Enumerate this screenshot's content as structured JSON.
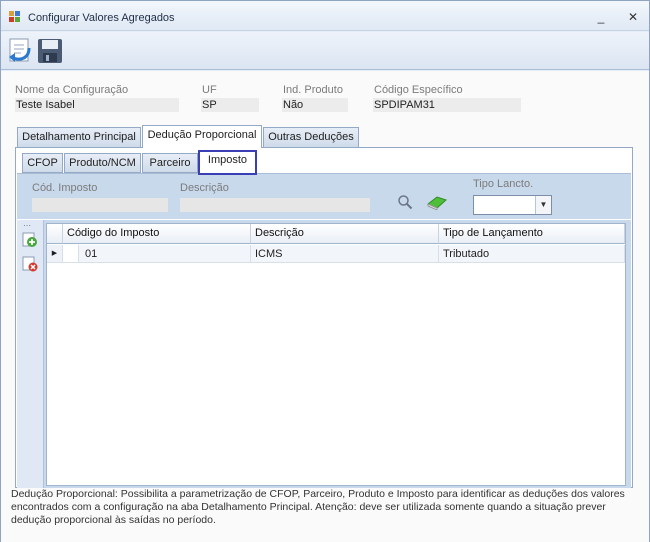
{
  "window": {
    "title": "Configurar Valores Agregados",
    "minimize": "_",
    "close": "✕"
  },
  "toolbar": {
    "icons": [
      "undo-icon",
      "save-icon"
    ]
  },
  "header": {
    "config_name_label": "Nome da Configuração",
    "config_name_value": "Teste Isabel",
    "uf_label": "UF",
    "uf_value": "SP",
    "ind_produto_label": "Ind. Produto",
    "ind_produto_value": "Não",
    "codigo_especifico_label": "Código Específico",
    "codigo_especifico_value": "SPDIPAM31"
  },
  "tabs": [
    {
      "label": "Detalhamento Principal",
      "active": false
    },
    {
      "label": "Dedução Proporcional",
      "active": true
    },
    {
      "label": "Outras Deduções",
      "active": false
    }
  ],
  "subtabs": [
    {
      "label": "CFOP",
      "active": false
    },
    {
      "label": "Produto/NCM",
      "active": false
    },
    {
      "label": "Parceiro",
      "active": false
    },
    {
      "label": "Imposto",
      "active": true
    }
  ],
  "filter": {
    "cod_imposto_label": "Cód. Imposto",
    "descricao_label": "Descrição",
    "tipo_lancto_label": "Tipo Lancto."
  },
  "grid": {
    "columns": [
      "Código do Imposto",
      "Descrição",
      "Tipo de Lançamento"
    ],
    "rows": [
      {
        "codigo": "01",
        "descricao": "ICMS",
        "tipo": "Tributado"
      }
    ]
  },
  "footer_text": "Dedução Proporcional: Possibilita a parametrização de CFOP, Parceiro, Produto e Imposto para identificar as deduções dos valores encontrados com a configuração na aba Detalhamento Principal. Atenção: deve ser utilizada somente quando a situação prever dedução proporcional às saídas no período.",
  "colors": {
    "active_subtab_border": "#3b3fb5",
    "filter_bg": "#c9d9ec"
  }
}
